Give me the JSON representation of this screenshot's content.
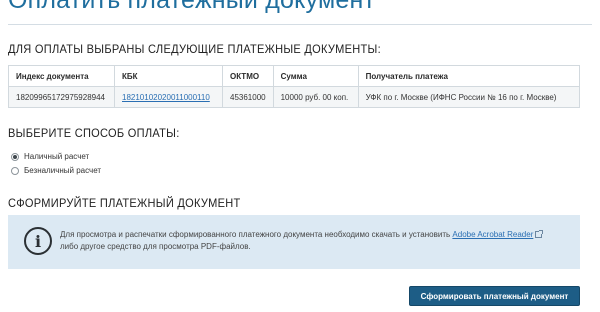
{
  "page": {
    "title": "Оплатить платежный документ"
  },
  "documents_section": {
    "heading": "ДЛЯ ОПЛАТЫ ВЫБРАНЫ СЛЕДУЮЩИЕ ПЛАТЕЖНЫЕ ДОКУМЕНТЫ:",
    "columns": [
      "Индекс документа",
      "КБК",
      "ОКТМО",
      "Сумма",
      "Получатель платежа"
    ],
    "rows": [
      {
        "index": "18209965172975928944",
        "kbk": "18210102020011000110",
        "oktmo": "45361000",
        "sum": "10000 руб. 00 коп.",
        "recipient": "УФК по г. Москве (ИФНС России № 16 по г. Москве)"
      }
    ]
  },
  "payment_method": {
    "heading": "ВЫБЕРИТЕ СПОСОБ ОПЛАТЫ:",
    "options": [
      {
        "label": "Наличный расчет",
        "checked": true
      },
      {
        "label": "Безналичный расчет",
        "checked": false
      }
    ]
  },
  "form_section": {
    "heading": "СФОРМИРУЙТЕ ПЛАТЕЖНЫЙ ДОКУМЕНТ",
    "info_line1_before": "Для просмотра и распечатки сформированного платежного документа необходимо скачать и установить ",
    "info_link": "Adobe Acrobat Reader",
    "info_line2": "либо другое средство для просмотра PDF-файлов.",
    "info_icon": "info-icon",
    "submit_label": "Сформировать платежный документ"
  },
  "colors": {
    "title": "#1f6e9e",
    "button": "#1d5d86",
    "info_bg": "#dce9f3",
    "link": "#2a6fb3"
  }
}
